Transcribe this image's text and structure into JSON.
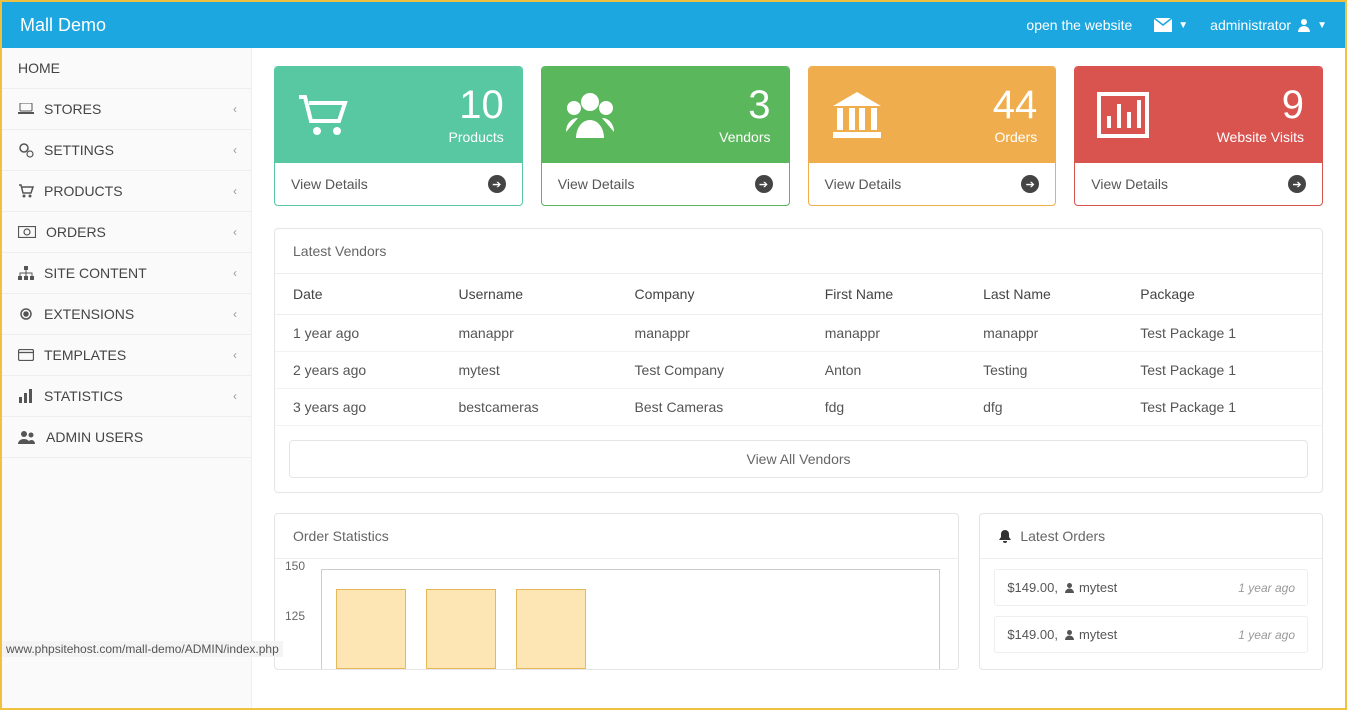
{
  "header": {
    "brand": "Mall Demo",
    "open_site": "open the website",
    "admin": "administrator"
  },
  "sidebar": {
    "home": "HOME",
    "items": [
      {
        "label": "STORES",
        "icon": "laptop"
      },
      {
        "label": "SETTINGS",
        "icon": "cogs"
      },
      {
        "label": "PRODUCTS",
        "icon": "cart"
      },
      {
        "label": "ORDERS",
        "icon": "money"
      },
      {
        "label": "SITE CONTENT",
        "icon": "sitemap"
      },
      {
        "label": "EXTENSIONS",
        "icon": "gear"
      },
      {
        "label": "TEMPLATES",
        "icon": "window"
      },
      {
        "label": "STATISTICS",
        "icon": "bar-chart"
      },
      {
        "label": "ADMIN USERS",
        "icon": "users"
      }
    ]
  },
  "cards": [
    {
      "value": "10",
      "label": "Products",
      "link": "View Details",
      "color": "teal",
      "icon": "cart"
    },
    {
      "value": "3",
      "label": "Vendors",
      "link": "View Details",
      "color": "green",
      "icon": "users"
    },
    {
      "value": "44",
      "label": "Orders",
      "link": "View Details",
      "color": "orange",
      "icon": "bank"
    },
    {
      "value": "9",
      "label": "Website Visits",
      "link": "View Details",
      "color": "red",
      "icon": "bar-chart"
    }
  ],
  "vendors_panel": {
    "title": "Latest Vendors",
    "columns": [
      "Date",
      "Username",
      "Company",
      "First Name",
      "Last Name",
      "Package"
    ],
    "rows": [
      [
        "1 year ago",
        "manappr",
        "manappr",
        "manappr",
        "manappr",
        "Test Package 1"
      ],
      [
        "2 years ago",
        "mytest",
        "Test Company",
        "Anton",
        "Testing",
        "Test Package 1"
      ],
      [
        "3 years ago",
        "bestcameras",
        "Best Cameras",
        "fdg",
        "dfg",
        "Test Package 1"
      ]
    ],
    "view_all": "View All Vendors"
  },
  "stats_panel": {
    "title": "Order Statistics"
  },
  "latest_orders_panel": {
    "title": "Latest Orders",
    "items": [
      {
        "amount": "$149.00,",
        "user": "mytest",
        "ago": "1 year ago"
      },
      {
        "amount": "$149.00,",
        "user": "mytest",
        "ago": "1 year ago"
      }
    ]
  },
  "chart_data": {
    "type": "bar",
    "title": "Order Statistics",
    "ylim": [
      0,
      150
    ],
    "yticks_visible": [
      150,
      125
    ],
    "values_visible": [
      140,
      140,
      140
    ],
    "note": "Only top portion of chart visible in screenshot; three bars shown at approximately y≈140 each."
  },
  "statusbar": "www.phpsitehost.com/mall-demo/ADMIN/index.php"
}
